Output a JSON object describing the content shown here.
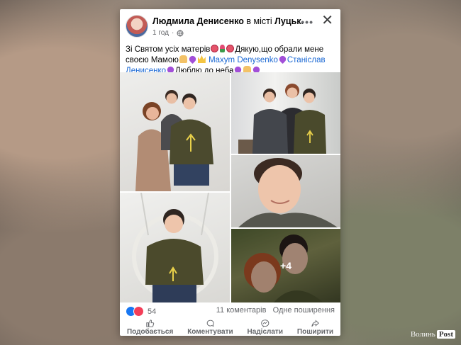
{
  "post": {
    "author": "Людмила Денисенко",
    "location_prefix": "в місті",
    "location": "Луцьк.",
    "time": "1 год",
    "privacy_icon": "globe-icon",
    "text_part1": "Зі Святом усіх матерів",
    "text_part2": "Дякую,що обрали мене своєю Мамою",
    "mention1": "Maxym Denysenko",
    "mention2": "Станіслав Денисенко",
    "text_part3": "Люблю до неба",
    "more_photos": "+4"
  },
  "stats": {
    "reactions_count": "54",
    "comments": "11 коментарів",
    "shares": "Одне поширення"
  },
  "actions": {
    "like": "Подобається",
    "comment": "Коментувати",
    "send": "Надіслати",
    "share": "Поширити"
  },
  "watermark": {
    "left": "Волинь",
    "right": "Post"
  }
}
